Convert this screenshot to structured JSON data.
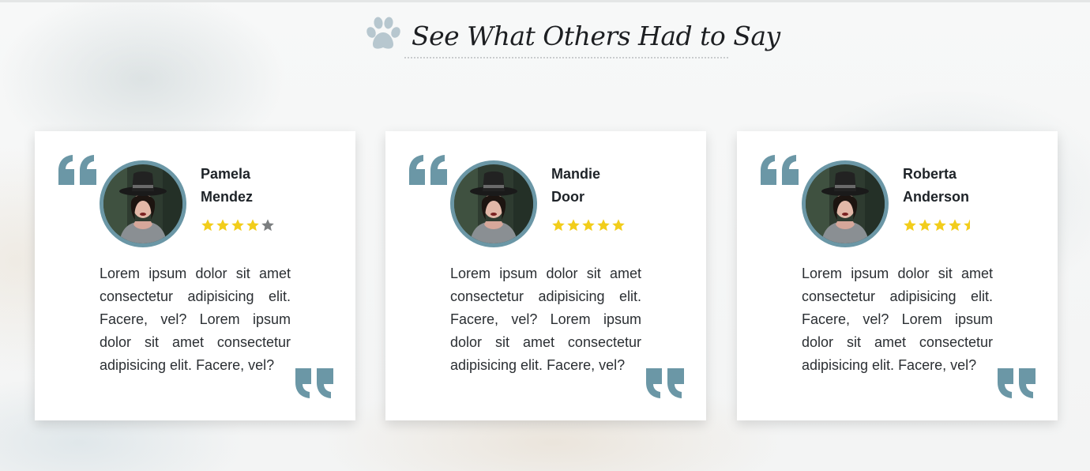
{
  "header": {
    "title": "See What Others Had to Say",
    "icon": "paw-icon"
  },
  "colors": {
    "accent": "#6b97a6",
    "star": "#f2cd1b",
    "star_empty": "#7b7e80",
    "paw": "#b7c7cf"
  },
  "testimonials": [
    {
      "name_line1": "Pamela",
      "name_line2": "Mendez",
      "rating": 4,
      "text": "Lorem ipsum dolor sit amet consectetur adipisicing elit. Facere, vel? Lorem ipsum dolor sit amet consectetur adipisicing elit. Facere, vel?"
    },
    {
      "name_line1": "Mandie",
      "name_line2": "Door",
      "rating": 5,
      "text": "Lorem ipsum dolor sit amet consectetur adipisicing elit. Facere, vel? Lorem ipsum dolor sit amet consectetur adipisicing elit. Facere, vel?"
    },
    {
      "name_line1": "Roberta",
      "name_line2": "Anderson",
      "rating": 4.5,
      "text": "Lorem ipsum dolor sit amet consectetur adipisicing elit. Facere, vel? Lorem ipsum dolor sit amet consectetur adipisicing elit. Facere, vel?"
    }
  ]
}
